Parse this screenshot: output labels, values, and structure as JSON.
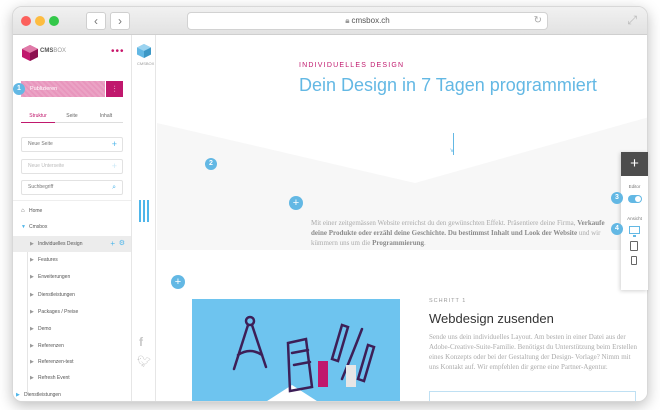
{
  "browser": {
    "url": "cmsbox.ch",
    "back_icon": "chevron-left-icon",
    "forward_icon": "chevron-right-icon"
  },
  "cms": {
    "logo_brand": "CMS",
    "logo_suffix": "BOX",
    "publish_label": "Publizieren",
    "tabs": [
      "Struktur",
      "Seite",
      "Inhalt"
    ],
    "new_page": "Neue Seite",
    "new_subpage": "Neue Unterseite",
    "search_placeholder": "Suchbegriff",
    "tree": {
      "home": "Home",
      "root": "Cmsbox",
      "items": [
        "Individuelles Design",
        "Features",
        "Erweiterungen",
        "Dienstleistungen",
        "Packages / Preise",
        "Demo",
        "Referenzen",
        "Referenzen-test",
        "Refresh Event"
      ],
      "footer": "Dienstleistungen"
    }
  },
  "narrow": {
    "logo_brand": "CMS",
    "logo_suffix": "BOX"
  },
  "badges": [
    "1",
    "2",
    "3",
    "4"
  ],
  "content": {
    "eyebrow": "INDIVIDUELLES DESIGN",
    "title": "Dein Design in 7 Tagen programmiert",
    "intro": {
      "p1": "Mit einer zeitgemässen Website erreichst du den gewünschten Effekt. Präsentiere deine Firma,",
      "b1": "Verkaufe deine Produkte oder erzähl deine Geschichte.",
      "b2": "Du bestimmst Inhalt und Look der Website",
      "p2": "und wir kümmern uns um die",
      "b3": "Programmierung",
      "p3": "."
    },
    "step_label": "SCHRITT 1",
    "step_title": "Webdesign zusenden",
    "step_text": "Sende uns dein individuelles Layout. Am besten in einer Datei aus der Adobe-Creative-Suite-Familie. Benötigst du Unterstützung beim Erstellen eines Konzepts oder bei der Gestaltung der Design- Vorlage? Nimm mit uns Kontakt auf. Wir empfehlen dir gerne eine Partner-Agentur."
  },
  "toolbar": {
    "editor_label": "Editor",
    "view_label": "Ansicht"
  },
  "colors": {
    "accent_pink": "#c0186d",
    "accent_blue": "#63b8e4"
  }
}
